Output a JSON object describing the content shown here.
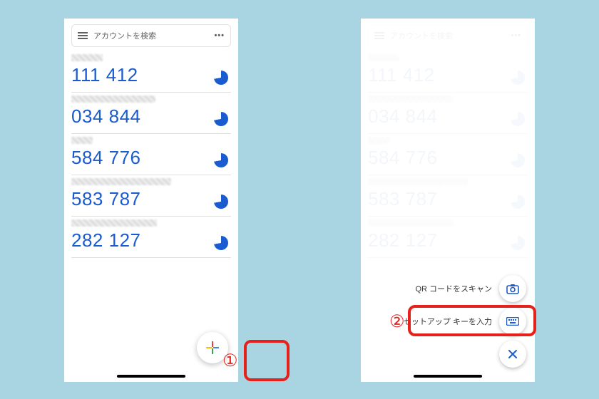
{
  "search": {
    "placeholder": "アカウントを検索",
    "menu_more": "•••"
  },
  "accounts": [
    {
      "label_w": 44,
      "code": "111 412"
    },
    {
      "label_w": 118,
      "code": "034 844"
    },
    {
      "label_w": 30,
      "code": "584 776"
    },
    {
      "label_w": 140,
      "code": "583 787"
    },
    {
      "label_w": 120,
      "code": "282 127"
    }
  ],
  "callouts": {
    "step1": "①",
    "step2": "②"
  },
  "fab_menu": {
    "scan_qr": "QR コードをスキャン",
    "enter_key": "セットアップ キーを入力",
    "close": "✕"
  }
}
